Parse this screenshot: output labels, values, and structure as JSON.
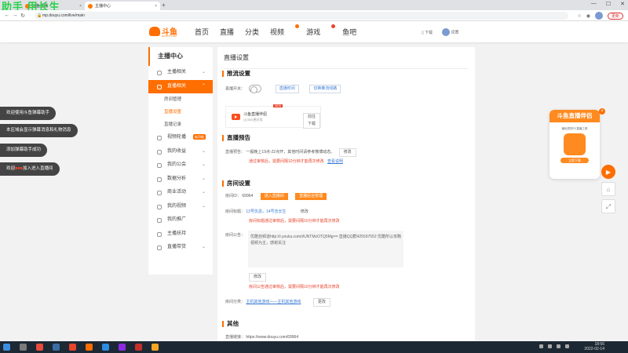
{
  "browser": {
    "tabs": [
      {
        "title": "斗鱼直播"
      },
      {
        "title": "主播中心"
      }
    ],
    "new_tab": "+",
    "url": "mp.douyu.com/live/main",
    "update_label": "更新",
    "window_controls": [
      "—",
      "☐",
      "✕"
    ]
  },
  "overlay_text": "助手 用长生",
  "site": {
    "logo_text": "斗鱼",
    "logo_sub": "DOUYU.COM",
    "nav": [
      "首页",
      "直播",
      "分类",
      "视频",
      "游戏",
      "鱼吧"
    ],
    "download_label": "下载",
    "user_label": "设置"
  },
  "sidebar": {
    "title": "主播中心",
    "items": [
      {
        "label": "主播相关",
        "chevron": "⌄"
      },
      {
        "label": "直播相关",
        "chevron": "⌃",
        "active": true
      },
      {
        "label": "房间管理",
        "sub": true
      },
      {
        "label": "直播设置",
        "sub": true,
        "current": true
      },
      {
        "label": "直播记录",
        "sub": true
      },
      {
        "label": "视频轮播",
        "chevron": "⌄",
        "badge": "新功能"
      },
      {
        "label": "我的收益",
        "chevron": "⌄"
      },
      {
        "label": "我的公会",
        "chevron": "⌄"
      },
      {
        "label": "数据分析",
        "chevron": "⌄"
      },
      {
        "label": "商业活动",
        "chevron": "⌄"
      },
      {
        "label": "我的视频",
        "chevron": "⌄"
      },
      {
        "label": "我的推广",
        "chevron": ""
      },
      {
        "label": "主播扶持",
        "chevron": ""
      },
      {
        "label": "直播带货",
        "chevron": "⌄"
      }
    ]
  },
  "main": {
    "page_title": "直播设置",
    "push": {
      "title": "推流设置",
      "switch_label": "直播开关：",
      "link1": "直播时间",
      "link2": "切换推流线路",
      "tool_name": "斗鱼直播伴侣",
      "tool_sub": "让OBS更好用",
      "tool_new": "NEW",
      "download": "前往下载"
    },
    "preview": {
      "title": "直播预告",
      "label": "直播预告：",
      "text": "一般晚上19点-22点开，其他时间请参考微博动态。",
      "edit": "修改",
      "warn": "通过审核后，需要间隔10分钟才能再次修改",
      "link": "查看说明"
    },
    "room": {
      "title": "房间设置",
      "id_label": "房间ID：",
      "id_value": "69964",
      "btn_enter": "进入直播间",
      "btn_backend": "直播后台管理",
      "title_label": "房间标题：",
      "title_value": "13号仇恩，14号吉长生",
      "title_edit": "修改",
      "title_warn": "房间标题通过审核后，需要间隔10分钟才能再次修改",
      "notice_label": "房间公告：",
      "notice_text": "优酷自频道http://i.youku.com/i/UNTMzOTQ5Mg== 直播QQ群425597552 优酷所以攻略视频为主，感谢关注",
      "notice_edit": "修改",
      "notice_warn": "房间公告通过审核后，需要间隔10分钟才能再次修改",
      "category_label": "房间分类：",
      "category_value": "主机其他游戏——主机其他游戏",
      "category_edit": "更改"
    },
    "other": {
      "title": "其他",
      "link_label": "直播链接：",
      "link_value": "https://www.douyu.com/69964"
    }
  },
  "danmaku_helper": [
    "欢迎使用斗鱼弹幕助手",
    "本区域会显示弹幕消息和礼物消息",
    "添加弹幕助手成功"
  ],
  "welcome_msg": {
    "prefix": "欢迎",
    "name": "■■■",
    "suffix": "加入进入直播间"
  },
  "promo": {
    "title": "斗鱼直播伴侣",
    "sub": "最优质的PC直播工具",
    "cta": "立即下载",
    "close": "×"
  },
  "side_tools": [
    "▶",
    "⌂",
    "⤢"
  ],
  "taskbar": {
    "time": "18:56",
    "date": "2022-02-14"
  },
  "colors": {
    "accent": "#ff6e00",
    "link": "#3a7bd5",
    "warn": "#e8442c",
    "taskbar": "#1c2833"
  }
}
